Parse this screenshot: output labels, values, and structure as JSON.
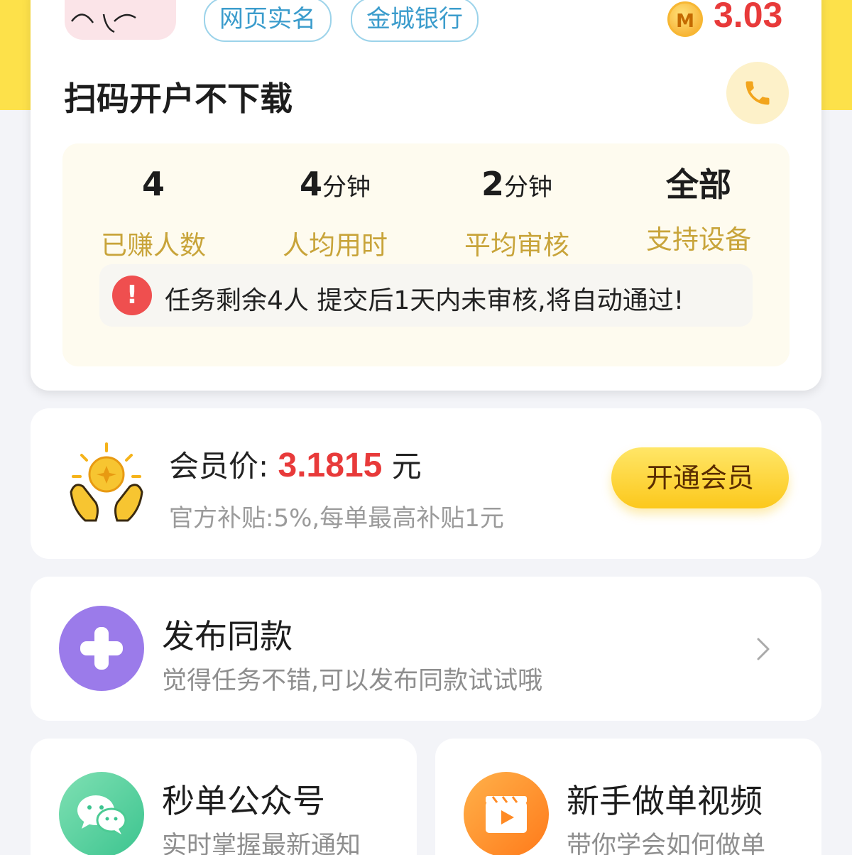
{
  "task": {
    "tags": [
      "网页实名",
      "金城银行"
    ],
    "coin_letter": "M",
    "reward": "3.03",
    "title": "扫码开户不下载",
    "stats": [
      {
        "value": "4",
        "unit": "",
        "label": "已赚人数"
      },
      {
        "value": "4",
        "unit": "分钟",
        "label": "人均用时"
      },
      {
        "value": "2",
        "unit": "分钟",
        "label": "平均审核"
      },
      {
        "value": "全部",
        "unit": "",
        "label": "支持设备"
      }
    ],
    "notice": {
      "icon_text": "!",
      "text": "任务剩余4人  提交后1天内未审核,将自动通过!"
    }
  },
  "member": {
    "label": "会员价:",
    "price": "3.1815",
    "unit": "元",
    "subtitle": "官方补贴:5%,每单最高补贴1元",
    "button": "开通会员"
  },
  "publish": {
    "title": "发布同款",
    "subtitle": "觉得任务不错,可以发布同款试试哦"
  },
  "wechat": {
    "title": "秒单公众号",
    "subtitle": "实时掌握最新通知"
  },
  "video": {
    "title": "新手做单视频",
    "subtitle": "带你学会如何做单"
  },
  "icons": {
    "phone": "phone-icon",
    "member": "hands-sun-coin-icon",
    "publish": "plus-icon",
    "wechat": "wechat-icon",
    "video": "video-clapper-icon",
    "chevron": "chevron-right-icon"
  },
  "colors": {
    "header_yellow": "#fde14a",
    "accent_red": "#e83a3a",
    "stat_label_gold": "#c8a43a",
    "tag_blue": "#3b9ccc",
    "publish_purple": "#9b7bea"
  }
}
